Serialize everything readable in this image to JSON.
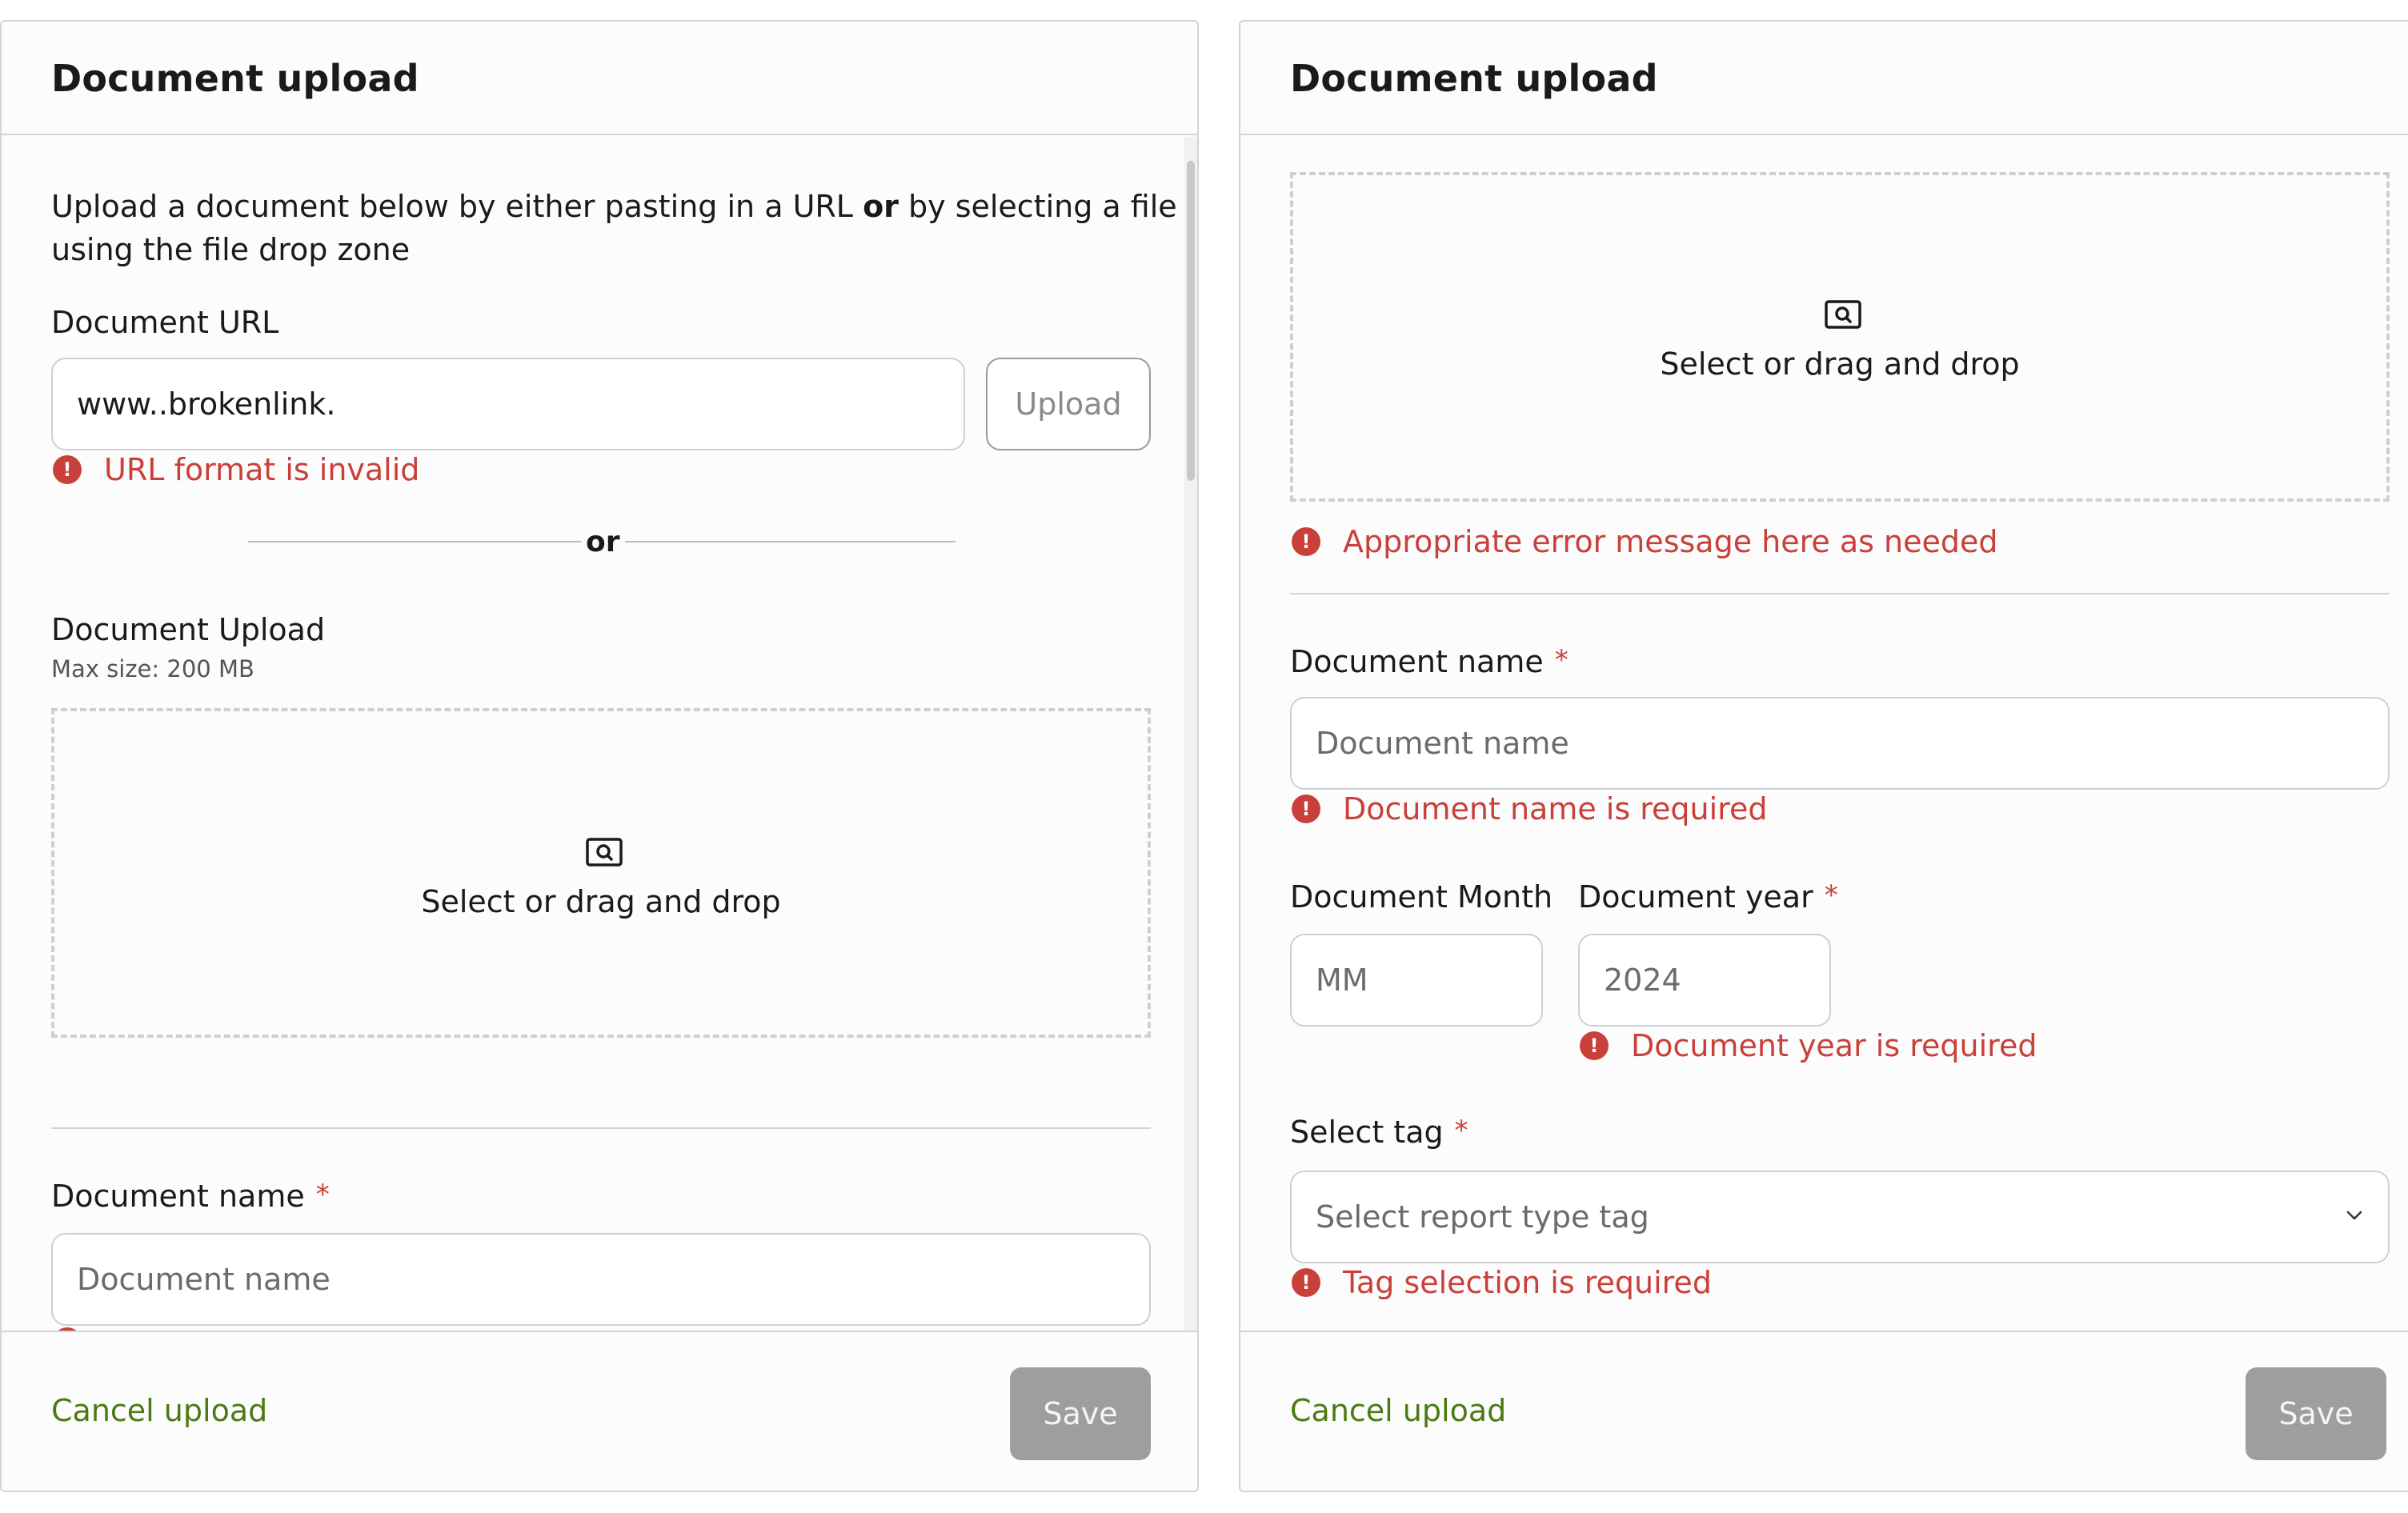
{
  "left_panel": {
    "title": "Document upload",
    "intro_before": "Upload a document below by either pasting in a URL ",
    "intro_bold": "or",
    "intro_after": " by selecting a file",
    "intro_line2": "using the file drop zone",
    "url_label": "Document URL",
    "url_value": "www..brokenlink.",
    "upload_button": "Upload",
    "url_error": "URL format is invalid",
    "or_divider": "or",
    "upload_label": "Document Upload",
    "max_size": "Max size: 200 MB",
    "dropzone_text": "Select or drag and drop",
    "doc_name_label": "Document name",
    "required_mark": "*",
    "doc_name_placeholder": "Document name",
    "cancel": "Cancel upload",
    "save": "Save"
  },
  "right_panel": {
    "title": "Document upload",
    "dropzone_text": "Select or drag and drop",
    "dropzone_error": "Appropriate error message here as needed",
    "doc_name_label": "Document name",
    "required_mark": "*",
    "doc_name_placeholder": "Document name",
    "doc_name_error": "Document name is required",
    "month_label": "Document Month",
    "month_placeholder": "MM",
    "year_label": "Document year",
    "year_placeholder": "2024",
    "year_error": "Document year is required",
    "tag_label": "Select tag",
    "tag_placeholder": "Select report type tag",
    "tag_error": "Tag selection is required",
    "cancel": "Cancel upload",
    "save": "Save"
  },
  "colors": {
    "error": "#c9403a",
    "link_green": "#4a7a12",
    "save_disabled": "#9e9e9e",
    "border": "#d4d4d4"
  }
}
